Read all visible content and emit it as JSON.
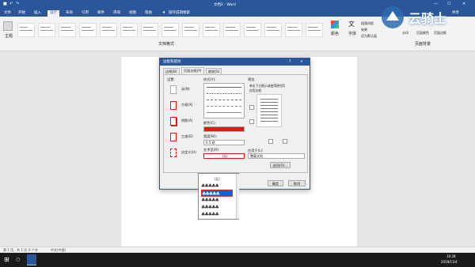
{
  "titlebar": {
    "title": "文档2 - Word"
  },
  "tabs": [
    "文件",
    "开始",
    "插入",
    "设计",
    "布局",
    "引用",
    "邮件",
    "审阅",
    "视图",
    "帮助"
  ],
  "tell_me": "操作说明搜索",
  "share": "共享",
  "ribbon": {
    "theme_label": "主题",
    "group_document_format": "文档格式",
    "colors_label": "颜色",
    "fonts_label": "字体",
    "paragraph_spacing": "段落间距",
    "effects": "效果",
    "set_default": "设为默认值",
    "watermark": "水印",
    "page_color": "页面颜色",
    "page_borders": "页面边框",
    "group_page_background": "页面背景"
  },
  "logo": {
    "text": "云骑士"
  },
  "dialog": {
    "title": "边框和底纹",
    "help": "?",
    "close": "×",
    "tabs": [
      "边框(B)",
      "页面边框(P)",
      "底纹(S)"
    ],
    "setting_label": "设置:",
    "settings": [
      "无(N)",
      "方框(X)",
      "阴影(A)",
      "三维(D)",
      "自定义(U)"
    ],
    "style_label": "样式(Y):",
    "color_label": "颜色(C):",
    "width_label": "宽度(W):",
    "width_value": "0.5 磅",
    "art_label": "艺术型(R):",
    "art_value": "(无)",
    "preview_label": "预览",
    "preview_hint": "单击下方图示或使用按钮可应用边框",
    "apply_label": "应用于(L):",
    "apply_value": "整篇文档",
    "options_btn": "选项(O)...",
    "ok": "确定",
    "cancel": "取消",
    "accent_color": "#e8160c"
  },
  "art_options": [
    "(无)",
    "♣♣♣♣♣",
    "♣♣♣♣♣",
    "♣♣♣♣♣",
    "♣♣♣♣♣",
    "♣♣♣♣♣"
  ],
  "status": {
    "page": "第 1 页，共 1 页",
    "words": "0 个字",
    "lang": "中文(中国)"
  },
  "taskbar": {
    "time": "10:28",
    "date": "2019/11/4"
  }
}
